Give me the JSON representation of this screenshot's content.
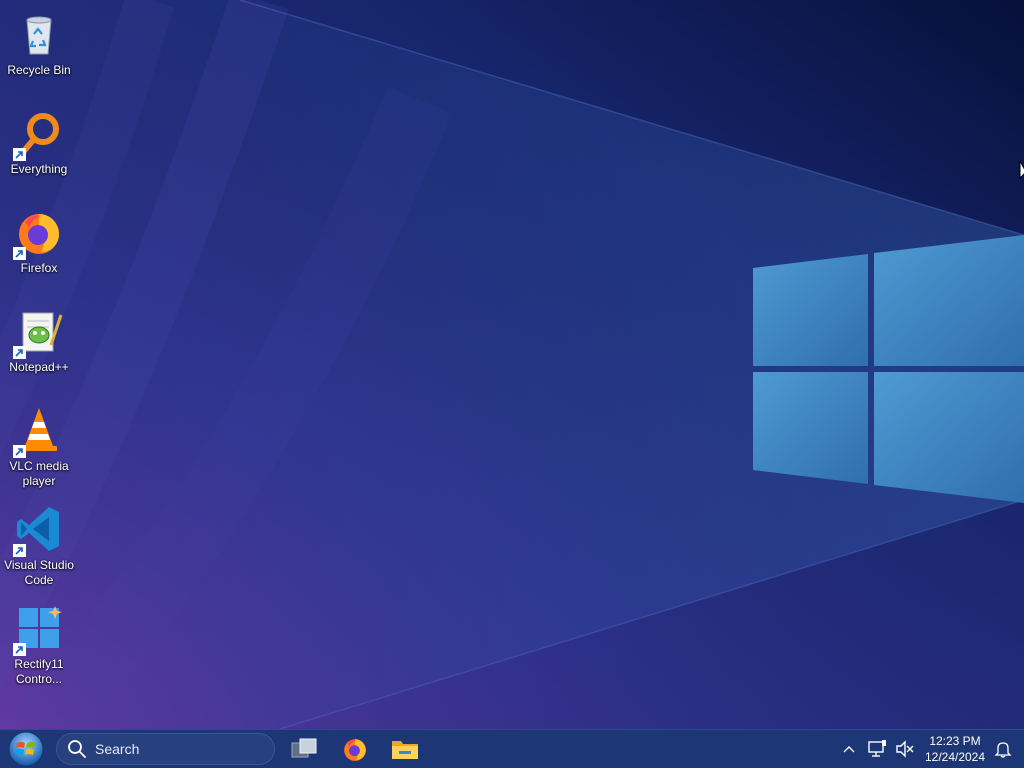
{
  "desktop": {
    "icons": [
      {
        "label": "Recycle Bin",
        "icon": "recycle-bin-icon",
        "shortcut": false
      },
      {
        "label": "Everything",
        "icon": "everything-search-icon",
        "shortcut": true
      },
      {
        "label": "Firefox",
        "icon": "firefox-icon",
        "shortcut": true
      },
      {
        "label": "Notepad++",
        "icon": "notepad-plus-plus-icon",
        "shortcut": true
      },
      {
        "label": "VLC media player",
        "icon": "vlc-cone-icon",
        "shortcut": true
      },
      {
        "label": "Visual Studio Code",
        "icon": "vscode-icon",
        "shortcut": true
      },
      {
        "label": "Rectify11 Contro...",
        "icon": "rectify11-control-panel-icon",
        "shortcut": true
      }
    ]
  },
  "taskbar": {
    "start_icon": "windows-orb-icon",
    "search_placeholder": "Search",
    "pinned": [
      {
        "name": "task-view",
        "icon": "task-view-icon"
      },
      {
        "name": "firefox",
        "icon": "firefox-icon"
      },
      {
        "name": "file-explorer",
        "icon": "folder-icon"
      }
    ],
    "tray": {
      "icons": [
        "chevron-up-icon",
        "network-icon",
        "volume-muted-icon",
        "notification-bell-icon"
      ],
      "time": "12:23 PM",
      "date": "12/24/2024"
    }
  },
  "colors": {
    "taskbar": "#1d3676",
    "wallpaper_dark": "#0b1238",
    "wallpaper_purple": "#3a2a7c",
    "windows_logo_blue": "#3d87c4"
  }
}
